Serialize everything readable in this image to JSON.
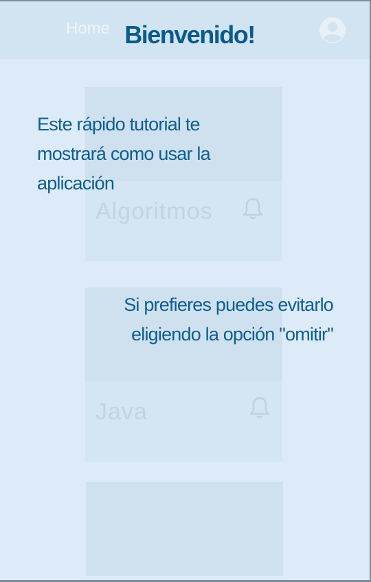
{
  "appbar": {
    "tab_label": "Home",
    "avatar_icon": "account-circle-icon"
  },
  "tutorial": {
    "title": "Bienvenido!",
    "message_1": "Este rápido tutorial te mostrará como usar la aplicación",
    "message_2": "Si prefieres  puedes evitarlo eligiendo la opción \"omitir\""
  },
  "cards": [
    {
      "name": "Algoritmos",
      "icon": "bell-icon"
    },
    {
      "name": "Java",
      "icon": "bell-icon"
    },
    {
      "name": ""
    }
  ],
  "colors": {
    "overlay": "#dcebf7",
    "accent_text": "#0b5a8c"
  }
}
